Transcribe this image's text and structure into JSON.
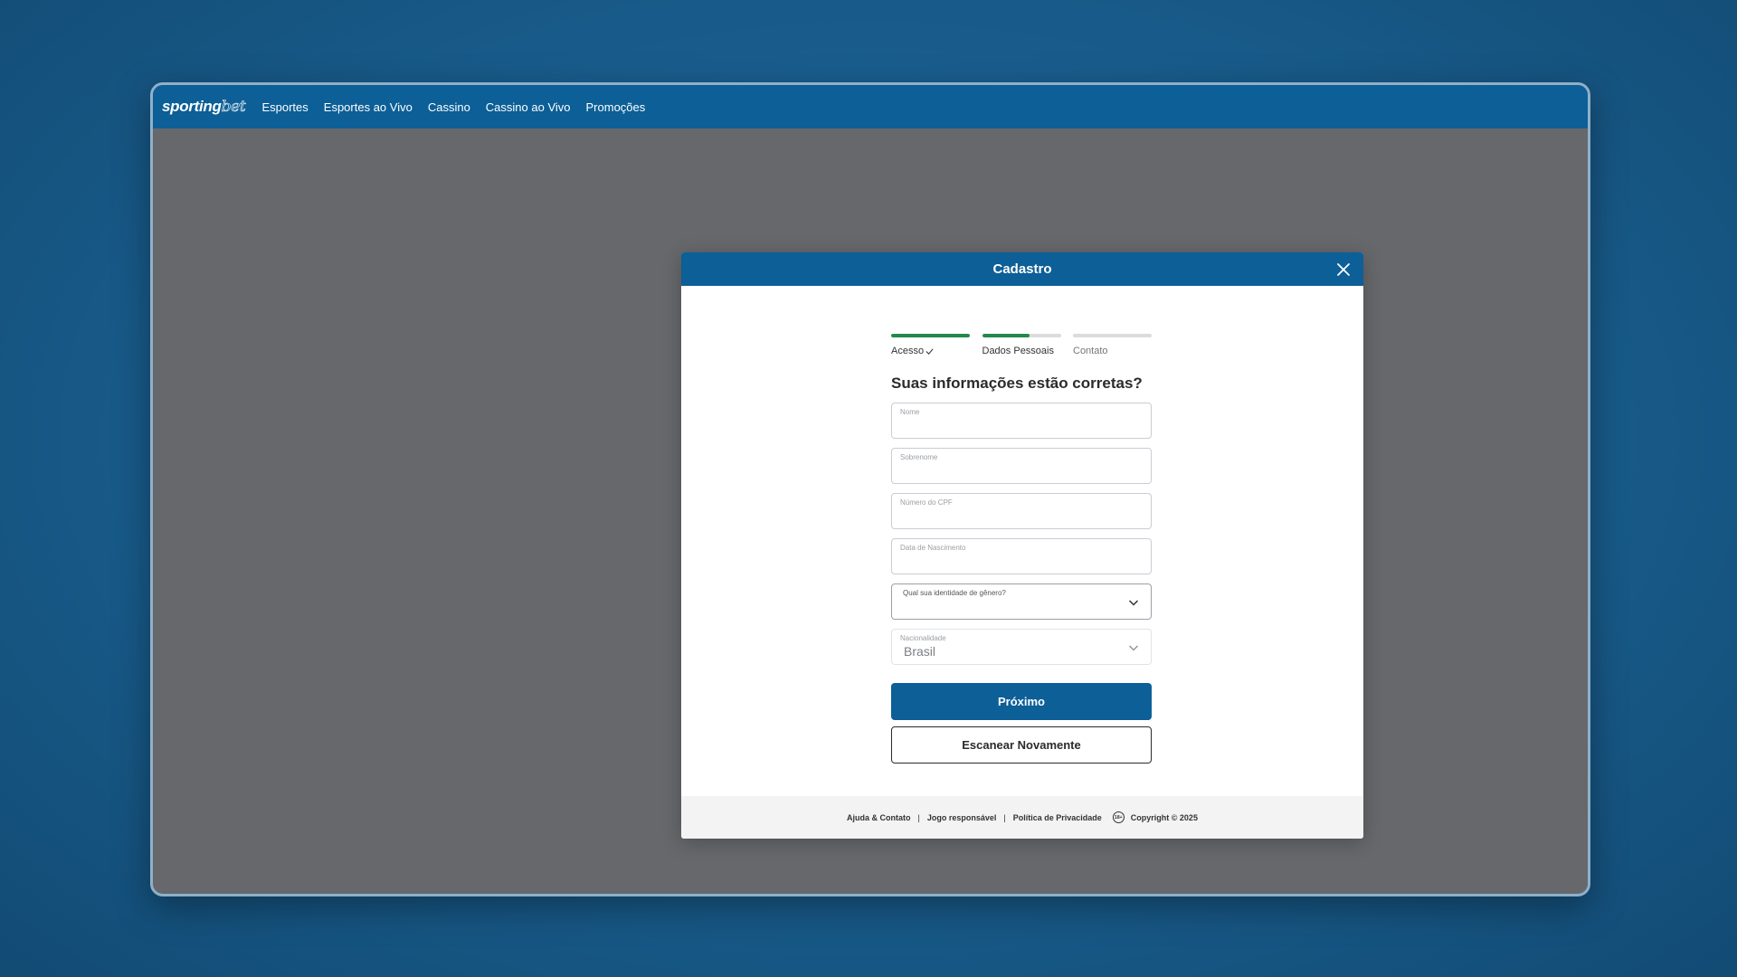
{
  "nav": {
    "brand_part1": "sporting",
    "brand_part2": "bet",
    "items": [
      {
        "label": "Esportes"
      },
      {
        "label": "Esportes ao Vivo"
      },
      {
        "label": "Cassino"
      },
      {
        "label": "Cassino ao Vivo"
      },
      {
        "label": "Promoções"
      }
    ]
  },
  "modal": {
    "title": "Cadastro",
    "steps": [
      {
        "label": "Acesso",
        "progress": 1.0,
        "completed": true
      },
      {
        "label": "Dados Pessoais",
        "progress": 0.6,
        "completed": false
      },
      {
        "label": "Contato",
        "progress": 0.0,
        "completed": false
      }
    ],
    "question": "Suas informações estão corretas?",
    "fields": {
      "nome": {
        "label": "Nome",
        "value": ""
      },
      "sobrenome": {
        "label": "Sobrenome",
        "value": ""
      },
      "cpf": {
        "label": "Número do CPF",
        "value": ""
      },
      "nascimento": {
        "label": "Data de Nascimento",
        "value": ""
      },
      "genero": {
        "label": "Qual sua identidade de gênero?",
        "value": ""
      },
      "nacionalidade": {
        "label": "Nacionalidade",
        "value": "Brasil"
      }
    },
    "primary_button": "Próximo",
    "secondary_button": "Escanear Novamente",
    "footer": {
      "help": "Ajuda & Contato",
      "responsible": "Jogo responsável",
      "privacy": "Política de Privacidade",
      "age_badge": "18+",
      "copyright": "Copyright © 2025",
      "separator": "|"
    }
  },
  "colors": {
    "brand_blue": "#0c5f97",
    "progress_green": "#1f8a4c",
    "overlay_gray": "#66686c"
  }
}
